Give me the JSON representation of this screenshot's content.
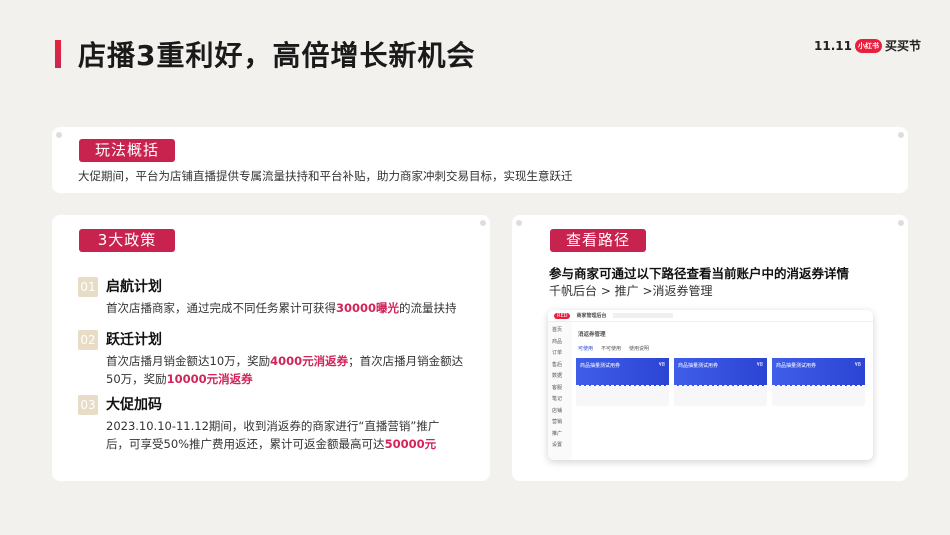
{
  "header": {
    "title": "店播3重利好，高倍增长新机会",
    "logo_text": "11.11",
    "logo_badge": "小红书",
    "logo_suffix": "买买节"
  },
  "overview": {
    "tag": "玩法概括",
    "text": "大促期间，平台为店铺直播提供专属流量扶持和平台补贴，助力商家冲刺交易目标，实现生意跃迁"
  },
  "policies": {
    "tag": "3大政策",
    "items": [
      {
        "num": "01",
        "title": "启航计划",
        "t1": "首次店播商家，通过完成不同任务累计可获得",
        "h1": "30000曝光",
        "t2": "的流量扶持"
      },
      {
        "num": "02",
        "title": "跃迁计划",
        "t1": "首次店播月销金额达10万，奖励",
        "h1": "4000元消返券",
        "t2": "；首次店播月销金额达50万，奖励",
        "h2": "10000元消返券"
      },
      {
        "num": "03",
        "title": "大促加码",
        "t1": "2023.10.10-11.12期间，收到消返券的商家进行“直播营销”推广后，可享受50%推广费用返还，累计可返金额最高可达",
        "h1": "50000元"
      }
    ]
  },
  "path": {
    "tag": "查看路径",
    "heading": "参与商家可通过以下路径查看当前账户中的消返券详情",
    "route": "千帆后台 > 推广 >消返券管理",
    "shot": {
      "app": "商家管理后台",
      "page_title": "消返券管理",
      "tabs": [
        "可使用",
        "不可使用",
        "使用说明"
      ],
      "coupon_title": "商品抽量测试用券",
      "coupon_value": "¥8",
      "side": [
        "首页",
        "商品",
        "订单",
        "售后",
        "数据",
        "客服",
        "笔记",
        "店铺",
        "营销",
        "推广",
        "设置"
      ]
    }
  }
}
